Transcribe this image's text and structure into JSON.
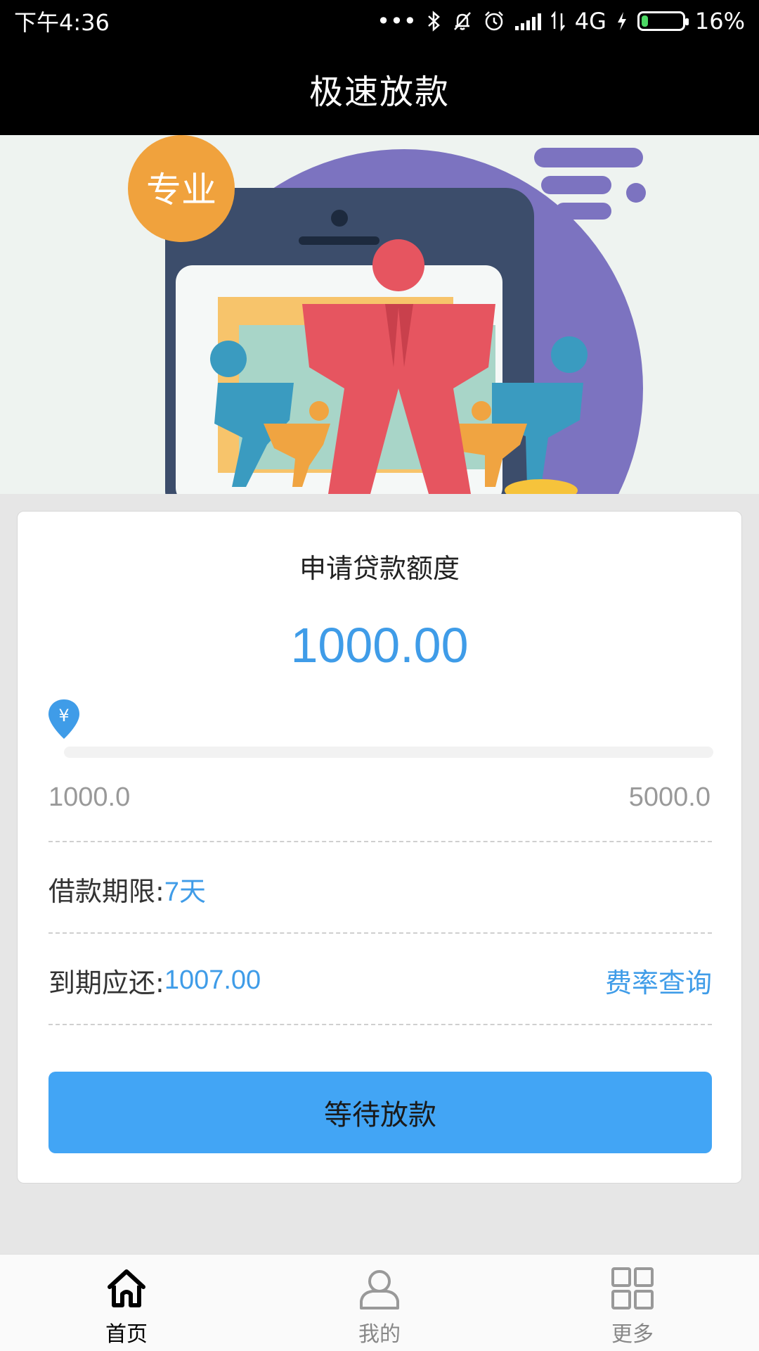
{
  "status_bar": {
    "time": "下午4:36",
    "network": "4G",
    "battery_percent": "16%",
    "battery_level": 0.16,
    "icons": [
      "more-dots-icon",
      "bluetooth-icon",
      "mute-icon",
      "alarm-icon",
      "signal-icon",
      "data-arrows-icon",
      "charging-icon",
      "battery-icon"
    ]
  },
  "header": {
    "title": "极速放款"
  },
  "banner": {
    "badge": "专业"
  },
  "loan": {
    "title": "申请贷款额度",
    "amount": "1000.00",
    "slider_min": "1000.0",
    "slider_max": "5000.0",
    "slider_value": 1000,
    "slider_range": [
      1000,
      5000
    ],
    "handle_symbol": "¥",
    "term_label": "借款期限:",
    "term_value": "7天",
    "due_label": "到期应还:",
    "due_value": "1007.00",
    "rate_link": "费率查询",
    "submit_label": "等待放款"
  },
  "nav": {
    "items": [
      {
        "label": "首页",
        "icon": "home-icon",
        "active": true
      },
      {
        "label": "我的",
        "icon": "user-icon",
        "active": false
      },
      {
        "label": "更多",
        "icon": "grid-icon",
        "active": false
      }
    ]
  },
  "colors": {
    "accent": "#3f9ce8",
    "button": "#42a5f5",
    "header_bg": "#000000"
  }
}
